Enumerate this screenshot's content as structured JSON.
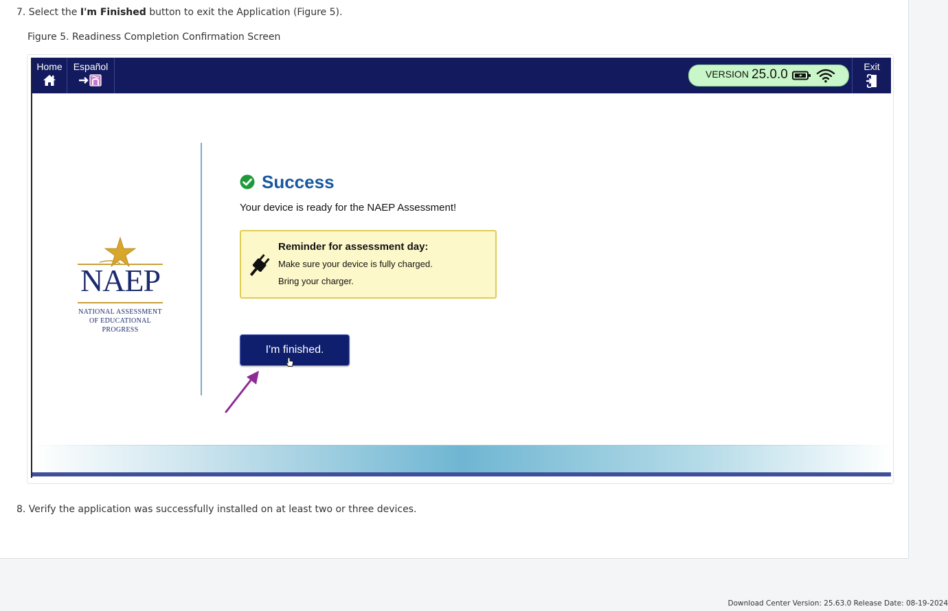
{
  "steps": {
    "step7_prefix": "7. Select the ",
    "step7_bold": "I'm Finished",
    "step7_suffix": " button to exit the Application (Figure 5).",
    "figure_caption": "Figure 5. Readiness Completion Confirmation Screen",
    "step8": "8. Verify the application was successfully installed on at least two or three devices."
  },
  "app": {
    "nav": {
      "home_label": "Home",
      "espanol_label": "Español",
      "exit_label": "Exit"
    },
    "status": {
      "version_label": "VERSION",
      "version_number": "25.0.0"
    },
    "logo": {
      "wordmark": "NAEP",
      "subtitle_line1": "NATIONAL ASSESSMENT",
      "subtitle_line2": "OF EDUCATIONAL",
      "subtitle_line3": "PROGRESS"
    },
    "content": {
      "success_title": "Success",
      "ready_message": "Your device is ready for the NAEP Assessment!",
      "reminder_title": "Reminder for assessment day:",
      "reminder_line1": "Make sure your device is fully charged.",
      "reminder_line2": "Bring your charger.",
      "finish_button": "I'm finished."
    }
  },
  "colors": {
    "topbar": "#131b5e",
    "success_blue": "#17589e",
    "success_check": "#1f9a3a",
    "button_navy": "#0f1f6e",
    "reminder_bg": "#fdf8c9",
    "arrow_purple": "#8e2a96",
    "version_pill": "#c9f7c9"
  },
  "footer": {
    "download_center": "Download Center Version: 25.63.0 Release Date: 08-19-2024"
  }
}
